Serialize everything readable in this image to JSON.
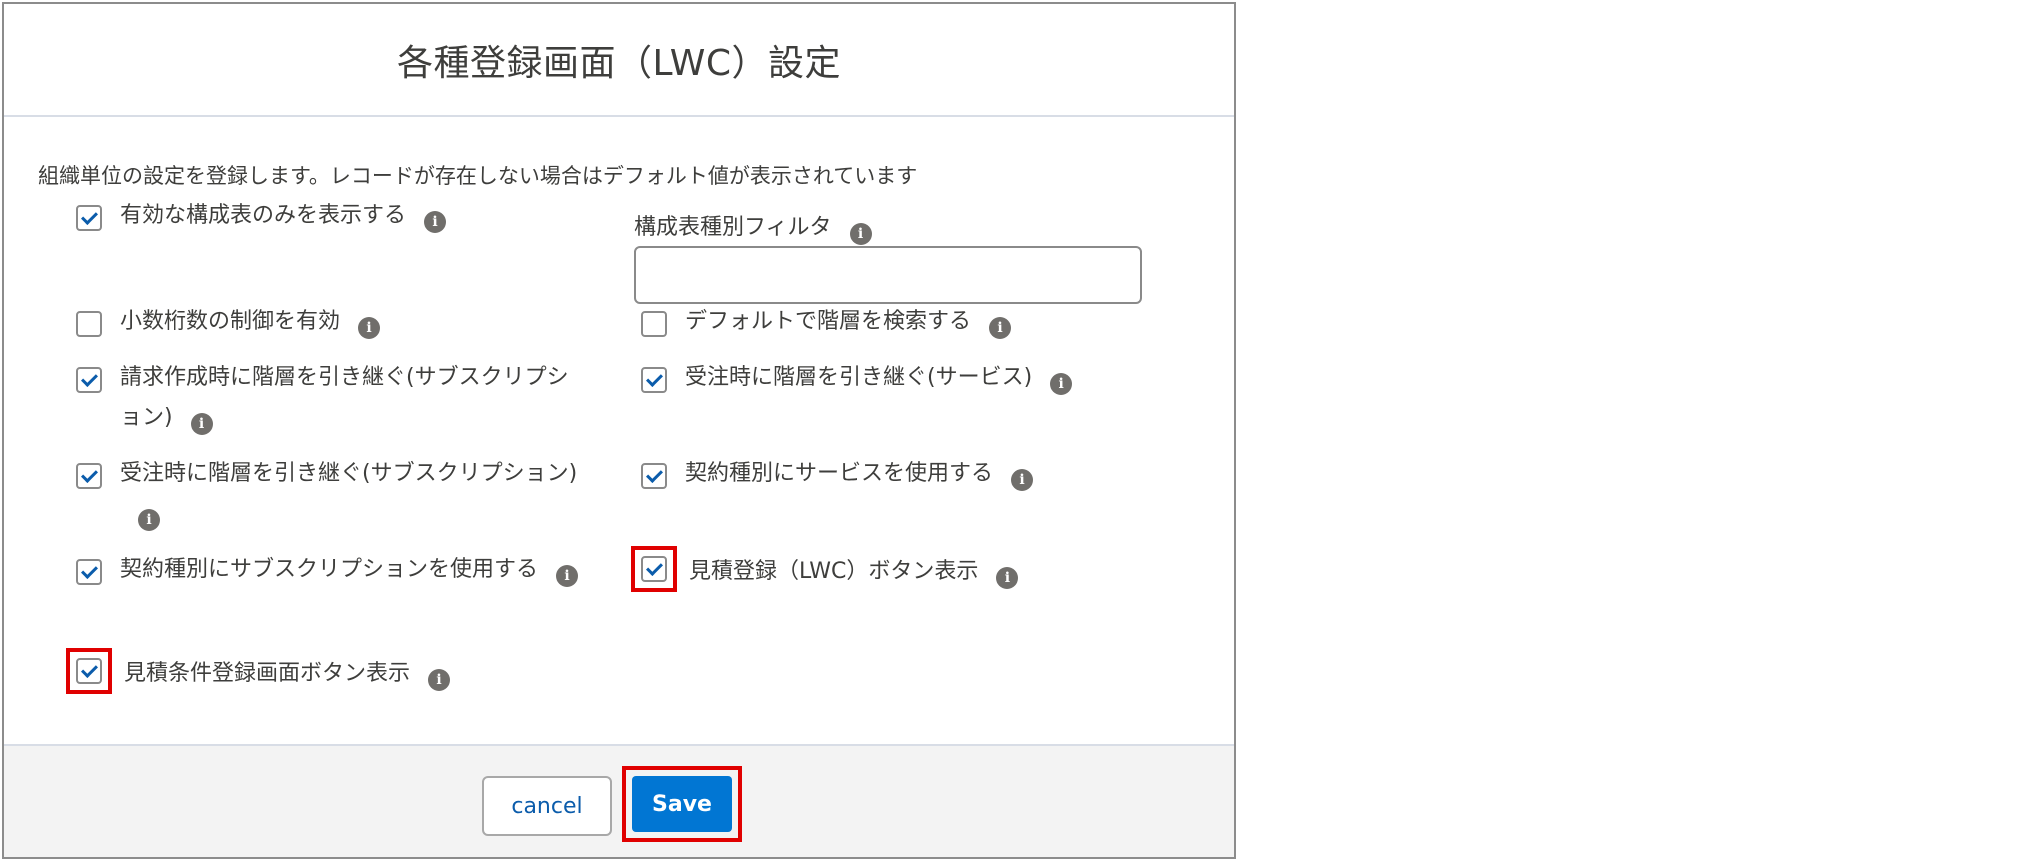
{
  "modal": {
    "title": "各種登録画面（LWC）設定",
    "description": "組織単位の設定を登録します。レコードが存在しない場合はデフォルト値が表示されています"
  },
  "left_checkboxes": [
    {
      "label": "有効な構成表のみを表示する",
      "checked": true,
      "highlighted": false
    },
    {
      "label": "小数桁数の制御を有効",
      "checked": false,
      "highlighted": false
    },
    {
      "label": "請求作成時に階層を引き継ぐ(サブスクリプション)",
      "checked": true,
      "highlighted": false
    },
    {
      "label": "受注時に階層を引き継ぐ(サブスクリプション)",
      "checked": true,
      "highlighted": false
    },
    {
      "label": "契約種別にサブスクリプションを使用する",
      "checked": true,
      "highlighted": false
    },
    {
      "label": "見積条件登録画面ボタン表示",
      "checked": true,
      "highlighted": true
    }
  ],
  "right_checkboxes": [
    {
      "label": "デフォルトで階層を検索する",
      "checked": false,
      "highlighted": false
    },
    {
      "label": "受注時に階層を引き継ぐ(サービス)",
      "checked": true,
      "highlighted": false
    },
    {
      "label": "契約種別にサービスを使用する",
      "checked": true,
      "highlighted": false
    },
    {
      "label": "見積登録（LWC）ボタン表示",
      "checked": true,
      "highlighted": true
    }
  ],
  "filter_field": {
    "label": "構成表種別フィルタ",
    "value": "",
    "placeholder": ""
  },
  "footer": {
    "cancel_label": "cancel",
    "save_label": "Save"
  },
  "icons": {
    "info": "info-icon"
  },
  "colors": {
    "primary": "#0176d3",
    "highlight": "#e00000",
    "check": "#0b5cab"
  }
}
